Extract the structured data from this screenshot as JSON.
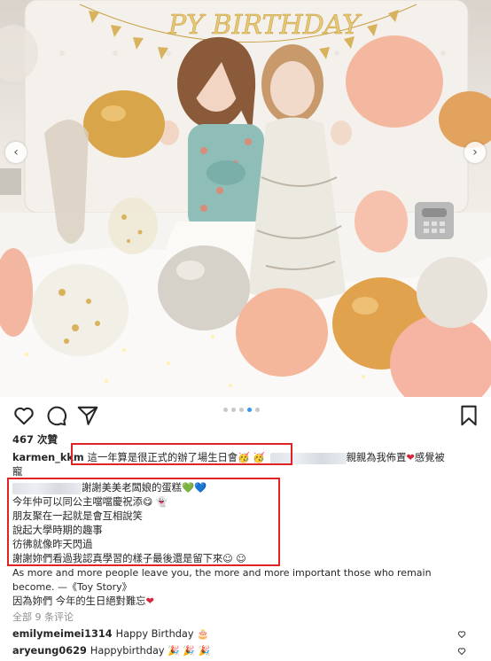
{
  "photo": {
    "banner_text": "PY BIRTHDAY",
    "prev_arrow": "‹",
    "next_arrow": "›",
    "carousel": {
      "count": 5,
      "active_index": 3
    }
  },
  "actions": {
    "like_icon": "heart-outline-icon",
    "comment_icon": "comment-bubble-icon",
    "share_icon": "paper-plane-icon",
    "save_icon": "bookmark-icon"
  },
  "post": {
    "likes": "467 次贊",
    "username": "karmen_kkm",
    "caption_part1": "這一年算是很正式的辦了場生日會",
    "caption_part1_emojis": "🥳 🥳",
    "caption_part2": "親親為我佈置",
    "caption_part2_heart": "❤",
    "caption_part3": "感覺被",
    "caption_line2": "寵",
    "caption_line3_text": "謝謝美美老闆娘的蛋糕",
    "caption_line3_hearts": [
      "💚",
      "💙"
    ],
    "caption_line4_text": "今年仲可以同公主噹噹慶祝添",
    "caption_line4_emojis": "😋 👻",
    "caption_line5": "朋友聚在一起就是會互相說笑",
    "caption_line6": "說起大學時期的趣事",
    "caption_line7": "彷彿就像昨天閃過",
    "caption_line8_text": "謝謝妳們看過我認真學習的樣子最後還是留下來",
    "caption_line8_emojis": "☺ ☺",
    "quote_line1": "As more and more people leave you, the more and more important those who remain",
    "quote_line2": "become. —《Toy Story》",
    "closing_text": "因為妳們 今年的生日絕對難忘",
    "closing_heart": "❤",
    "view_comments": "全部 9 条评论"
  },
  "comments": [
    {
      "user": "emilymeimei1314",
      "text": "Happy Birthday",
      "emoji": "🎂"
    },
    {
      "user": "aryeung0629",
      "text": "Happybirthday",
      "emoji": "🎉 🎉 🎉"
    }
  ],
  "colors": {
    "highlight_box": "#e02424",
    "carousel_active": "#3897f0",
    "heart_red": "#d6263b"
  }
}
